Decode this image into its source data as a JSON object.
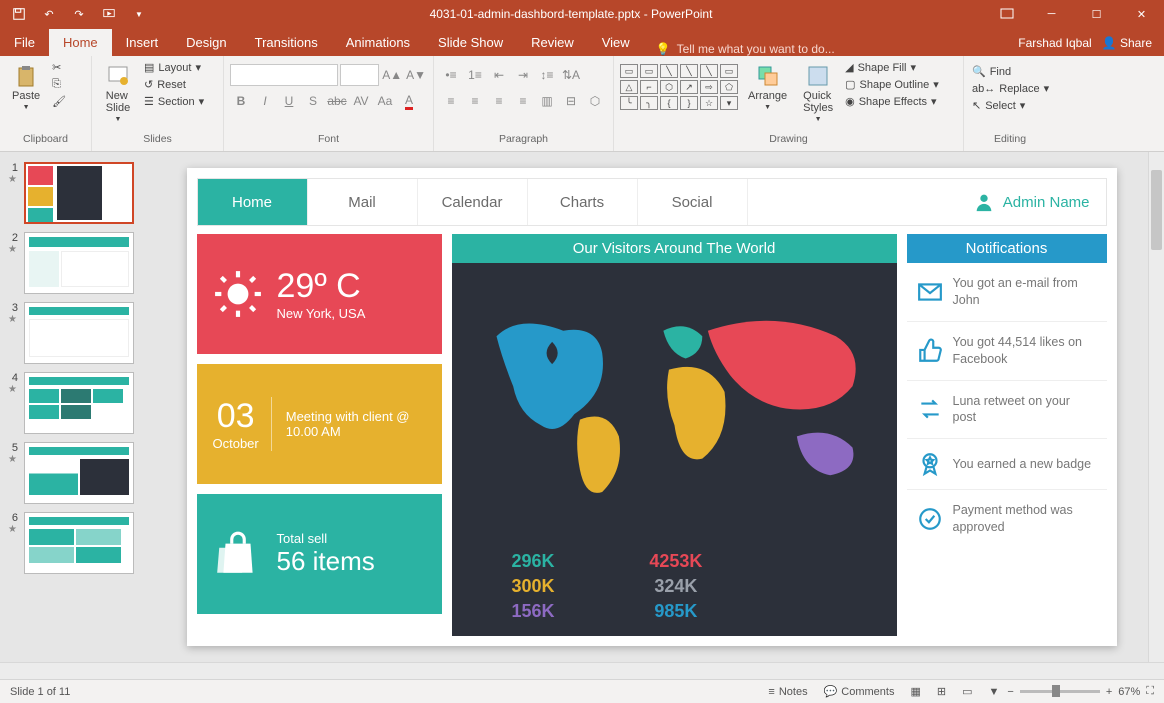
{
  "app": {
    "title_filename": "4031-01-admin-dashbord-template.pptx",
    "title_app": "PowerPoint",
    "user": "Farshad Iqbal",
    "share": "Share"
  },
  "menu": {
    "file": "File",
    "home": "Home",
    "insert": "Insert",
    "design": "Design",
    "transitions": "Transitions",
    "animations": "Animations",
    "slideshow": "Slide Show",
    "review": "Review",
    "view": "View",
    "tellme": "Tell me what you want to do..."
  },
  "ribbon": {
    "clipboard": {
      "label": "Clipboard",
      "paste": "Paste"
    },
    "slides": {
      "label": "Slides",
      "new": "New\nSlide",
      "layout": "Layout",
      "reset": "Reset",
      "section": "Section"
    },
    "font": {
      "label": "Font"
    },
    "paragraph": {
      "label": "Paragraph"
    },
    "drawing": {
      "label": "Drawing",
      "arrange": "Arrange",
      "quick": "Quick\nStyles",
      "fill": "Shape Fill",
      "outline": "Shape Outline",
      "effects": "Shape Effects"
    },
    "editing": {
      "label": "Editing",
      "find": "Find",
      "replace": "Replace",
      "select": "Select"
    }
  },
  "slide": {
    "tabs": {
      "home": "Home",
      "mail": "Mail",
      "calendar": "Calendar",
      "charts": "Charts",
      "social": "Social"
    },
    "admin": "Admin Name",
    "weather": {
      "temp": "29º C",
      "loc": "New York, USA"
    },
    "meeting": {
      "day": "03",
      "month": "October",
      "text": "Meeting with client @\n10.00 AM"
    },
    "sales": {
      "label": "Total sell",
      "value": "56 items"
    },
    "visitors": {
      "title": "Our Visitors Around The World",
      "s1": "296K",
      "s2": "4253K",
      "s3": "300K",
      "s4": "324K",
      "s5": "156K",
      "s6": "985K"
    },
    "notifications": {
      "title": "Notifications",
      "n1": "You got an e-mail from John",
      "n2": "You got 44,514 likes on Facebook",
      "n3": "Luna retweet on your post",
      "n4": "You earned a new badge",
      "n5": "Payment method was approved"
    }
  },
  "status": {
    "slide": "Slide 1 of 11",
    "notes": "Notes",
    "comments": "Comments",
    "zoom": "67%"
  }
}
